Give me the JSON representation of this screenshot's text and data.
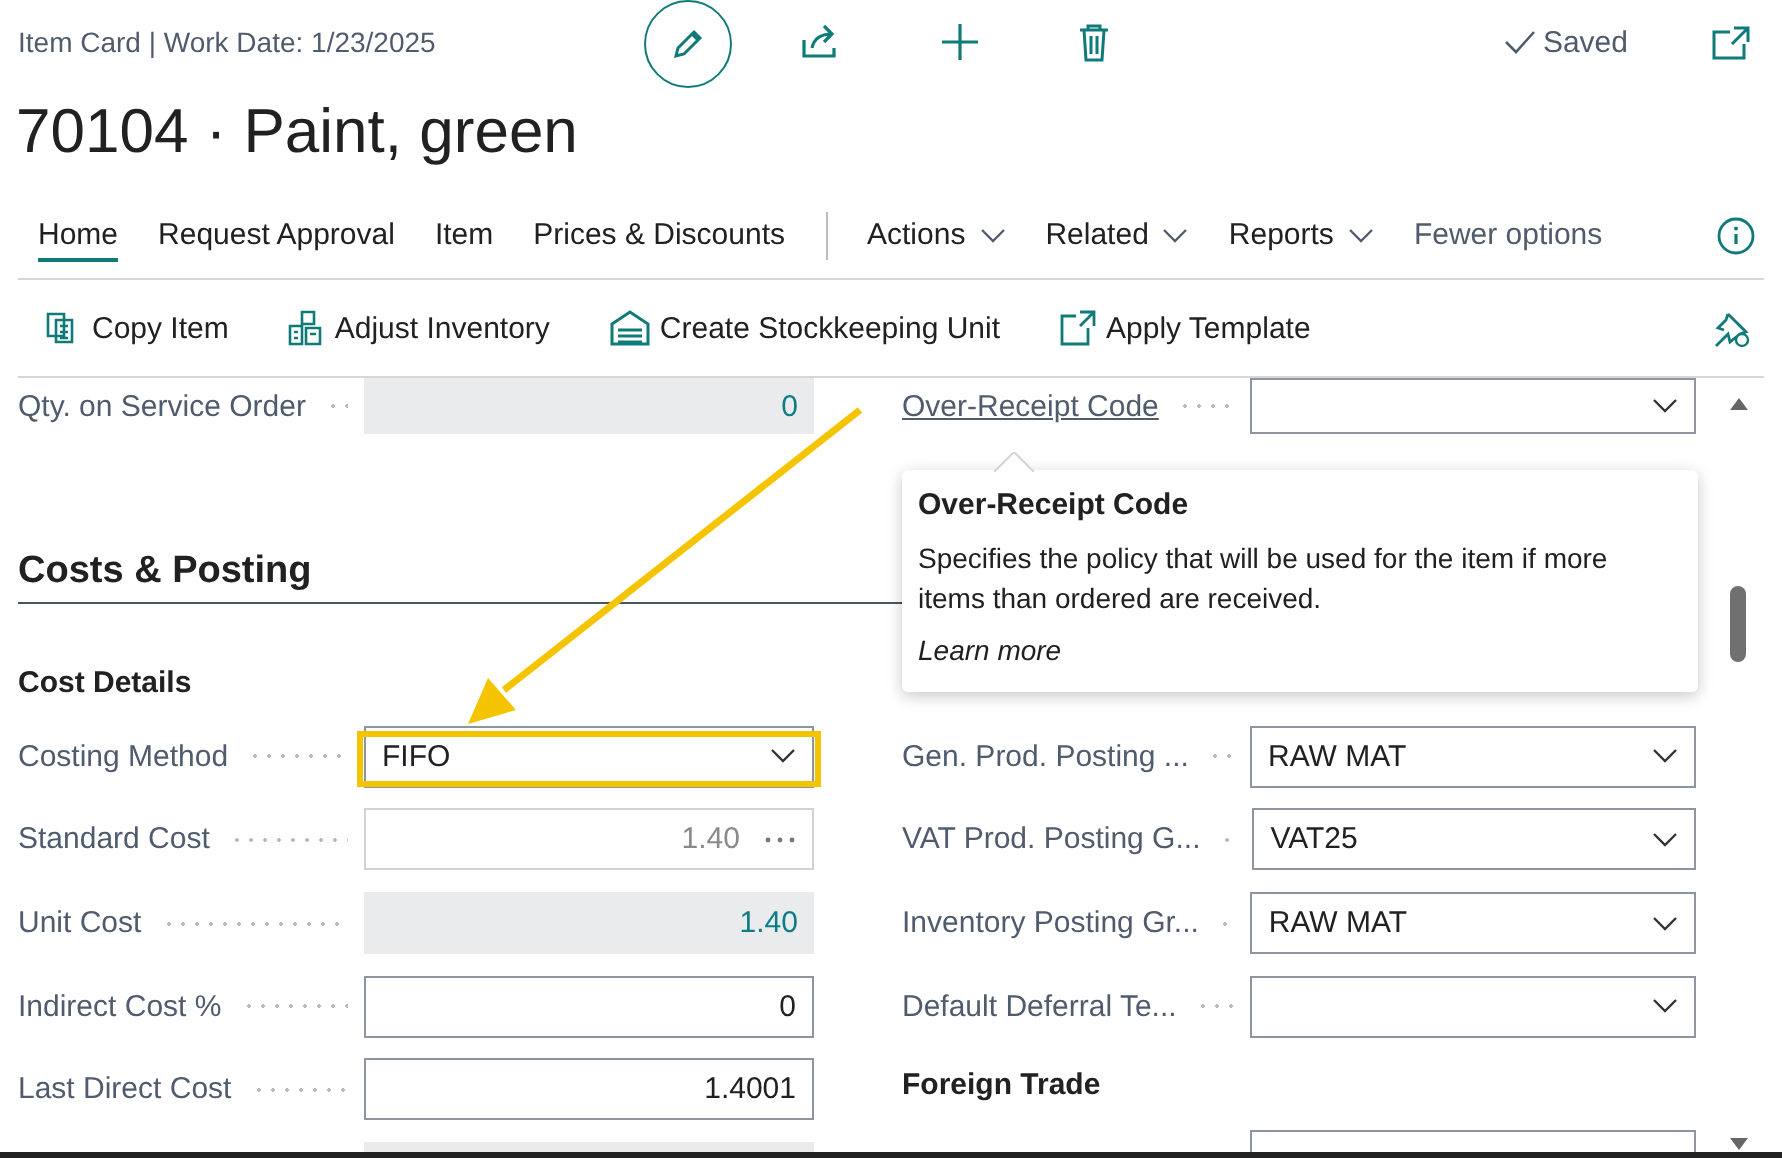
{
  "header": {
    "caption": "Item Card | Work Date: 1/23/2025",
    "status": "Saved"
  },
  "title": "70104 · Paint, green",
  "tabs": [
    {
      "label": "Home",
      "kind": "tab",
      "selected": true
    },
    {
      "label": "Request Approval",
      "kind": "tab",
      "selected": false
    },
    {
      "label": "Item",
      "kind": "tab",
      "selected": false
    },
    {
      "label": "Prices & Discounts",
      "kind": "tab",
      "selected": false
    },
    {
      "label": "Actions",
      "kind": "menu",
      "selected": false
    },
    {
      "label": "Related",
      "kind": "menu",
      "selected": false
    },
    {
      "label": "Reports",
      "kind": "menu",
      "selected": false
    },
    {
      "label": "Fewer options",
      "kind": "link",
      "selected": false
    }
  ],
  "actions": [
    {
      "label": "Copy Item",
      "kind": "copy"
    },
    {
      "label": "Adjust Inventory",
      "kind": "adjust"
    },
    {
      "label": "Create Stockkeeping Unit",
      "kind": "warehouse"
    },
    {
      "label": "Apply Template",
      "kind": "template"
    }
  ],
  "top_fields": [
    {
      "label": "Qty. on Service Order",
      "kind": "readonly",
      "value": "0",
      "underlined": false
    },
    {
      "label": "Over-Receipt Code",
      "kind": "dropdown",
      "underlined": true
    }
  ],
  "section": {
    "title": "Costs & Posting",
    "cost_details": {
      "title": "Cost Details",
      "fields": [
        {
          "label": "Costing Method",
          "kind": "dropdown",
          "value": "FIFO"
        },
        {
          "label": "Standard Cost",
          "kind": "lookup-disabled",
          "value": "1.40"
        },
        {
          "label": "Unit Cost",
          "kind": "readonly",
          "value": "1.40"
        },
        {
          "label": "Indirect Cost %",
          "kind": "input",
          "value": "0"
        },
        {
          "label": "Last Direct Cost",
          "kind": "input",
          "value": "1.4001"
        },
        {
          "kind": "readonly"
        }
      ]
    },
    "posting_details": {
      "fields": [
        {
          "label": "Gen. Prod. Posting ...",
          "kind": "dropdown",
          "value": "RAW MAT"
        },
        {
          "label": "VAT Prod. Posting G...",
          "kind": "dropdown",
          "value": "VAT25"
        },
        {
          "label": "Inventory Posting Gr...",
          "kind": "dropdown",
          "value": "RAW MAT"
        },
        {
          "label": "Default Deferral Te...",
          "kind": "dropdown"
        }
      ]
    },
    "foreign_trade": {
      "title": "Foreign Trade",
      "fields": [
        {
          "kind": "input"
        }
      ]
    }
  },
  "tooltip": {
    "title": "Over-Receipt Code",
    "text": "Specifies the policy that will be used for the item if more items than ordered are received.",
    "link": "Learn more"
  }
}
